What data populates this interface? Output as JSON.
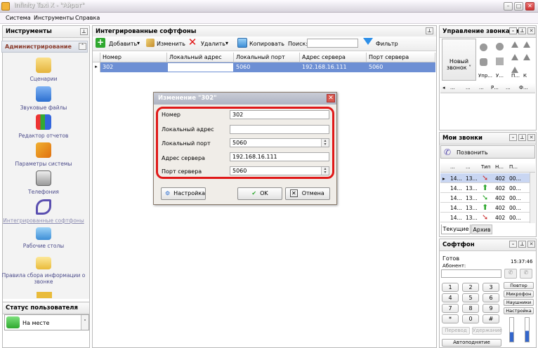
{
  "window": {
    "title": "Infinity Taxi X - \"Айрат\""
  },
  "menu": [
    "Система",
    "Инструменты",
    "Справка"
  ],
  "left": {
    "title": "Инструменты",
    "section": "Администрирование",
    "items": [
      "Сценарии",
      "Звуковые файлы",
      "Редактор отчетов",
      "Параметры системы",
      "Телефония",
      "Интегрированные софтфоны",
      "Рабочие столы",
      "Правила сбора информации о звонке"
    ],
    "status_title": "Статус пользователя",
    "status_value": "На месте"
  },
  "center": {
    "title": "Интегрированные софтфоны",
    "toolbar": {
      "add": "Добавить",
      "edit": "Изменить",
      "delete": "Удалить",
      "copy": "Копировать",
      "search_label": "Поиск:",
      "filter": "Фильтр"
    },
    "columns": [
      "Номер",
      "Локальный адрес",
      "Локальный порт",
      "Адрес сервера",
      "Порт сервера"
    ],
    "rows": [
      [
        "302",
        "",
        "5060",
        "192.168.16.111",
        "5060"
      ]
    ]
  },
  "dialog": {
    "title": "Изменение \"302\"",
    "fields": [
      {
        "label": "Номер",
        "value": "302"
      },
      {
        "label": "Локальный адрес",
        "value": ""
      },
      {
        "label": "Локальный порт",
        "value": "5060"
      },
      {
        "label": "Адрес сервера",
        "value": "192.168.16.111"
      },
      {
        "label": "Порт сервера",
        "value": "5060"
      }
    ],
    "settings": "Настройка",
    "ok": "OK",
    "cancel": "Отмена"
  },
  "calls": {
    "title": "Управление звонками",
    "new_call": "Новый звонок",
    "cols": [
      "Упр...",
      "У...",
      "П...",
      "К"
    ],
    "grid_cols": [
      "...",
      "...",
      "...",
      "Р...",
      "...",
      "Ф..."
    ]
  },
  "mycalls": {
    "title": "Мои звонки",
    "call": "Позвонить",
    "cols": [
      "...",
      "...",
      "Тип",
      "Н...",
      "П..."
    ],
    "rows": [
      [
        "14...",
        "13...",
        "402",
        "00..."
      ],
      [
        "14...",
        "13...",
        "402",
        "00..."
      ],
      [
        "14...",
        "13...",
        "402",
        "00..."
      ],
      [
        "14...",
        "13...",
        "402",
        "00..."
      ],
      [
        "14...",
        "13...",
        "402",
        "00..."
      ]
    ],
    "tabs": [
      "Текущие",
      "Архив"
    ]
  },
  "softphone": {
    "title": "Софтфон",
    "status": "Готов",
    "subscriber": "Абонент:",
    "time": "15:37:46",
    "keys": [
      "1",
      "2",
      "3",
      "4",
      "5",
      "6",
      "7",
      "8",
      "9",
      "*",
      "0",
      "#"
    ],
    "buttons": [
      "Повтор",
      "Микрофон",
      "Наушники",
      "Настройка"
    ],
    "transfer": "Перевод",
    "hold": "Удержание",
    "autoanswer": "Автоподнятие"
  }
}
